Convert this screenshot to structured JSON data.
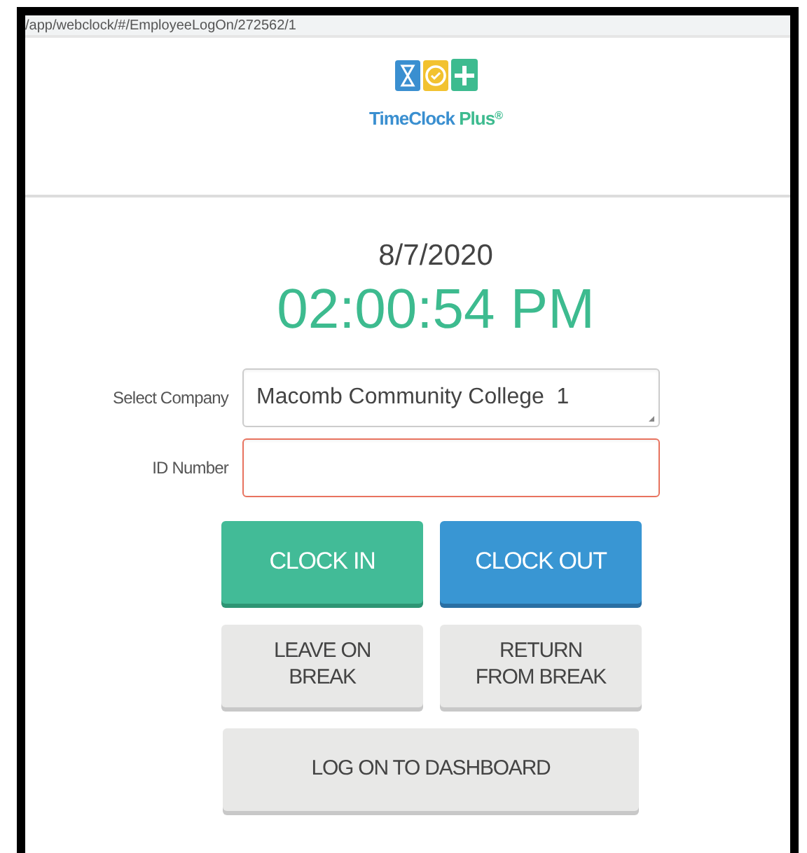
{
  "address_bar": {
    "url": "/app/webclock/#/EmployeeLogOn/272562/1"
  },
  "logo": {
    "name": "TimeClock",
    "suffix": "Plus",
    "mark": "®"
  },
  "clock": {
    "date": "8/7/2020",
    "time": "02:00:54 PM"
  },
  "form": {
    "fields": [
      {
        "kind": "select",
        "label": "Select Company",
        "value": "Macomb Community College  1",
        "invalid": false
      },
      {
        "kind": "text",
        "label": "ID Number",
        "invalid": true
      }
    ]
  },
  "action_rows": [
    [
      "CLOCK IN",
      "CLOCK OUT"
    ],
    [
      "LEAVE ON BREAK",
      "RETURN FROM BREAK"
    ]
  ],
  "dashboard_button": "LOG ON TO DASHBOARD"
}
